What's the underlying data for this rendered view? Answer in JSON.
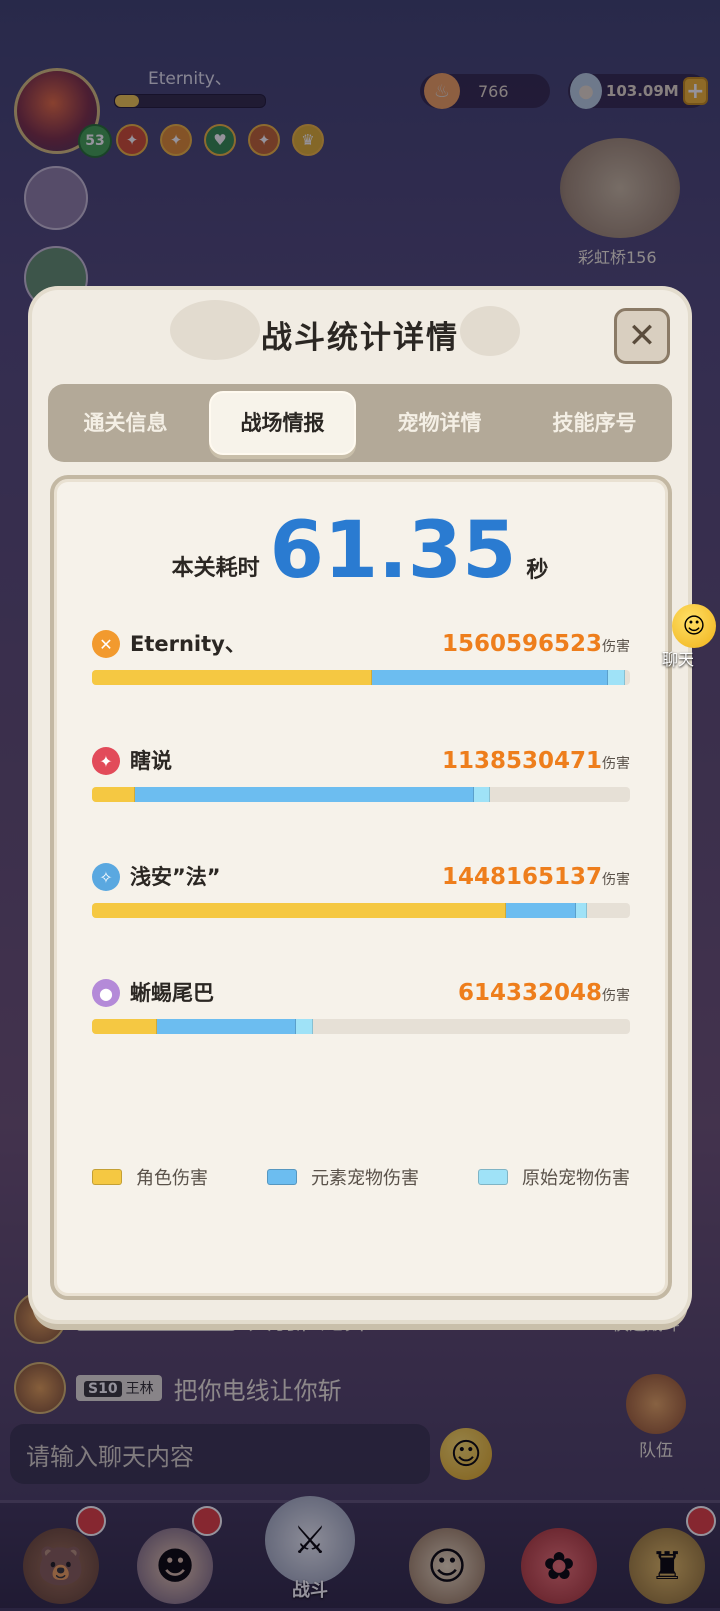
{
  "hud": {
    "player_name": "Eternity、",
    "level": "53",
    "stamina": "766",
    "coins": "103.09M",
    "plus_label": "+",
    "bridge_label": "彩虹桥156"
  },
  "chat": {
    "row1_tag_level": "S10",
    "row1_tag_name": "把酒临风·独晚吟",
    "row1_msg": "大羽雇龙舞",
    "row2_tag_level": "S10",
    "row2_tag_name": "王林",
    "row2_msg": "把你电线让你斩",
    "input_placeholder": "请输入聊天内容",
    "float_label": "聊天"
  },
  "side_buttons": {
    "quick_battle": "快速战斗",
    "team": "队伍"
  },
  "bottom_nav": {
    "battle": "战斗"
  },
  "dialog": {
    "title": "战斗统计详情",
    "close": "✕",
    "tabs": [
      "通关信息",
      "战场情报",
      "宠物详情",
      "技能序号"
    ],
    "active_tab": 1,
    "time_label": "本关耗时",
    "time_value": "61.35",
    "time_unit": "秒",
    "damage_unit": "伤害",
    "players": [
      {
        "name": "Eternity、",
        "damage": "1560596523",
        "icon": "crossed-swords-icon",
        "icon_color": "#f29a2e",
        "role": 0.52,
        "elem": 0.44,
        "orig": 0.03
      },
      {
        "name": "瞎说",
        "damage": "1138530471",
        "icon": "mask-icon",
        "icon_color": "#e24b5a",
        "role": 0.08,
        "elem": 0.63,
        "orig": 0.03
      },
      {
        "name": "浅安”法”",
        "damage": "1448165137",
        "icon": "staff-icon",
        "icon_color": "#5aa8e0",
        "role": 0.77,
        "elem": 0.13,
        "orig": 0.02
      },
      {
        "name": "蜥蜴尾巴",
        "damage": "614332048",
        "icon": "orb-icon",
        "icon_color": "#b48ad8",
        "role": 0.12,
        "elem": 0.26,
        "orig": 0.03
      }
    ],
    "legend": [
      {
        "label": "角色伤害",
        "color": "#f5c842"
      },
      {
        "label": "元素宠物伤害",
        "color": "#6cbdf0"
      },
      {
        "label": "原始宠物伤害",
        "color": "#9fe2f7"
      }
    ]
  }
}
